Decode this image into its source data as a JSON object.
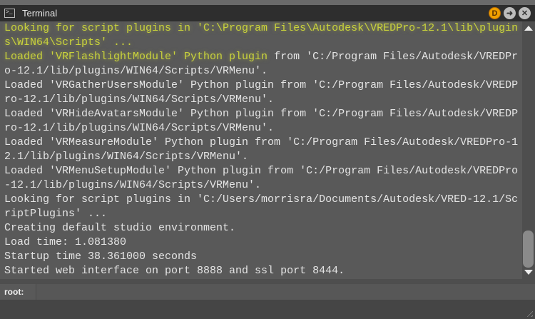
{
  "window": {
    "title": "Terminal"
  },
  "buttons": {
    "d": "D",
    "go": "➜",
    "close": "✕"
  },
  "output": {
    "lines": [
      {
        "hl": "Looking for script plugins in 'C:\\Program Files\\Autodesk\\VREDPro-12.1\\lib\\plugin",
        "rest": ""
      },
      {
        "hl": "s\\WIN64\\Scripts' ...",
        "rest": ""
      },
      {
        "hl": "Loaded 'VRFlashlightModule' Python plugin",
        "rest": " from 'C:/Program Files/Autodesk/VREDPr"
      },
      {
        "hl": "",
        "rest": "o-12.1/lib/plugins/WIN64/Scripts/VRMenu'."
      },
      {
        "hl": "",
        "rest": "Loaded 'VRGatherUsersModule' Python plugin from 'C:/Program Files/Autodesk/VREDP"
      },
      {
        "hl": "",
        "rest": "ro-12.1/lib/plugins/WIN64/Scripts/VRMenu'."
      },
      {
        "hl": "",
        "rest": "Loaded 'VRHideAvatarsModule' Python plugin from 'C:/Program Files/Autodesk/VREDP"
      },
      {
        "hl": "",
        "rest": "ro-12.1/lib/plugins/WIN64/Scripts/VRMenu'."
      },
      {
        "hl": "",
        "rest": "Loaded 'VRMeasureModule' Python plugin from 'C:/Program Files/Autodesk/VREDPro-1"
      },
      {
        "hl": "",
        "rest": "2.1/lib/plugins/WIN64/Scripts/VRMenu'."
      },
      {
        "hl": "",
        "rest": "Loaded 'VRMenuSetupModule' Python plugin from 'C:/Program Files/Autodesk/VREDPro"
      },
      {
        "hl": "",
        "rest": "-12.1/lib/plugins/WIN64/Scripts/VRMenu'."
      },
      {
        "hl": "",
        "rest": "Looking for script plugins in 'C:/Users/morrisra/Documents/Autodesk/VRED-12.1/Sc"
      },
      {
        "hl": "",
        "rest": "riptPlugins' ..."
      },
      {
        "hl": "",
        "rest": "Creating default studio environment."
      },
      {
        "hl": "",
        "rest": "Load time: 1.081380"
      },
      {
        "hl": "",
        "rest": "Startup time 38.361000 seconds"
      },
      {
        "hl": "",
        "rest": "Started web interface on port 8888 and ssl port 8444."
      }
    ]
  },
  "input": {
    "label": "root:",
    "value": ""
  }
}
